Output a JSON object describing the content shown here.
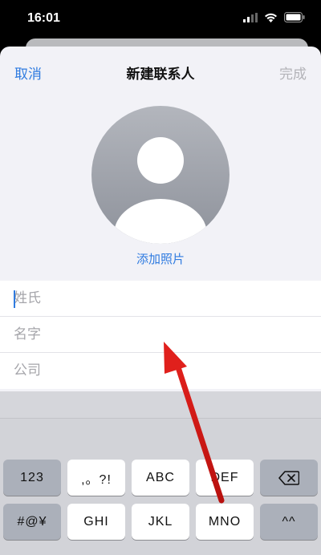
{
  "status_bar": {
    "time": "16:01"
  },
  "nav": {
    "cancel": "取消",
    "title": "新建联系人",
    "done": "完成"
  },
  "photo": {
    "add_label": "添加照片"
  },
  "form": {
    "last_name_placeholder": "姓氏",
    "first_name_placeholder": "名字",
    "company_placeholder": "公司"
  },
  "keyboard": {
    "row1": [
      "123",
      ",。?!",
      "ABC",
      "DEF"
    ],
    "row2": [
      "#@¥",
      "GHI",
      "JKL",
      "MNO",
      "^^"
    ]
  },
  "colors": {
    "accent": "#2f7be0",
    "arrow": "#e0201c"
  }
}
